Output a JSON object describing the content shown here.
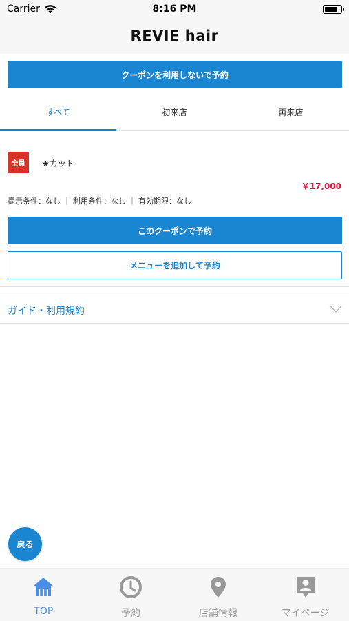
{
  "status_bar": {
    "carrier": "Carrier",
    "time": "8:16 PM"
  },
  "nav": {
    "title": "REVIE hair"
  },
  "top_button": {
    "label": "クーポンを利用しないで予約"
  },
  "tabs": [
    {
      "label": "すべて",
      "active": true
    },
    {
      "label": "初来店",
      "active": false
    },
    {
      "label": "再来店",
      "active": false
    }
  ],
  "coupon": {
    "badge": "全員",
    "name": "★カット",
    "price": "￥17,000",
    "conditions": "提示条件：なし ｜ 利用条件：なし ｜ 有効期限：なし",
    "book_label": "このクーポンで予約",
    "add_menu_label": "メニューを追加して予約"
  },
  "guide": {
    "label": "ガイド・利用規約"
  },
  "back_button": {
    "label": "戻る"
  },
  "tab_bar": {
    "items": [
      {
        "label": "TOP",
        "icon": "home-icon",
        "active": true
      },
      {
        "label": "予約",
        "icon": "clock-icon",
        "active": false
      },
      {
        "label": "店舗情報",
        "icon": "location-pin-icon",
        "active": false
      },
      {
        "label": "マイページ",
        "icon": "person-card-icon",
        "active": false
      }
    ]
  },
  "colors": {
    "primary": "#1a86d2",
    "badge": "#d9312a",
    "price": "#e0143c",
    "tab_active": "#4a8fe7",
    "tab_inactive": "#999999"
  }
}
